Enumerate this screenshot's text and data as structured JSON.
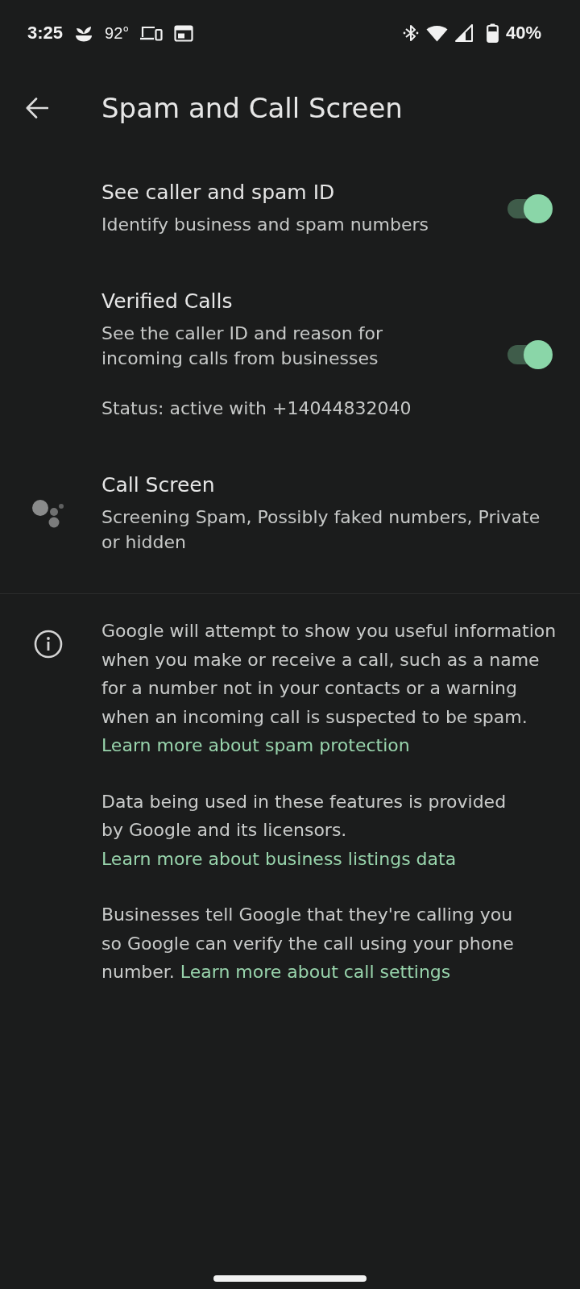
{
  "status_bar": {
    "time": "3:25",
    "temperature": "92°",
    "battery": "40%"
  },
  "header": {
    "title": "Spam and Call Screen"
  },
  "settings": [
    {
      "kind": "switch",
      "title": "See caller and spam ID",
      "summary": "Identify business and spam numbers",
      "on": true
    },
    {
      "kind": "switch",
      "title": "Verified Calls",
      "summary": "See the caller ID and reason for incoming calls from businesses",
      "status": "Status: active with +14044832040",
      "on": true
    },
    {
      "kind": "navigation",
      "title": "Call Screen",
      "summary": "Screening Spam, Possibly faked numbers, Private or hidden"
    }
  ],
  "info": {
    "paragraphs": [
      {
        "text": "Google will attempt to show you useful information when you make or receive a call, such as a name for a number not in your contacts or a warning when an incoming call is suspected to be spam.",
        "link": "Learn more about spam protection"
      },
      {
        "text": "Data being used in these features is provided by Google and its licensors.",
        "link": "Learn more about business listings data"
      },
      {
        "text": "Businesses tell Google that they're calling you so Google can verify the call using your phone number.",
        "link": "Learn more about call settings"
      }
    ]
  }
}
